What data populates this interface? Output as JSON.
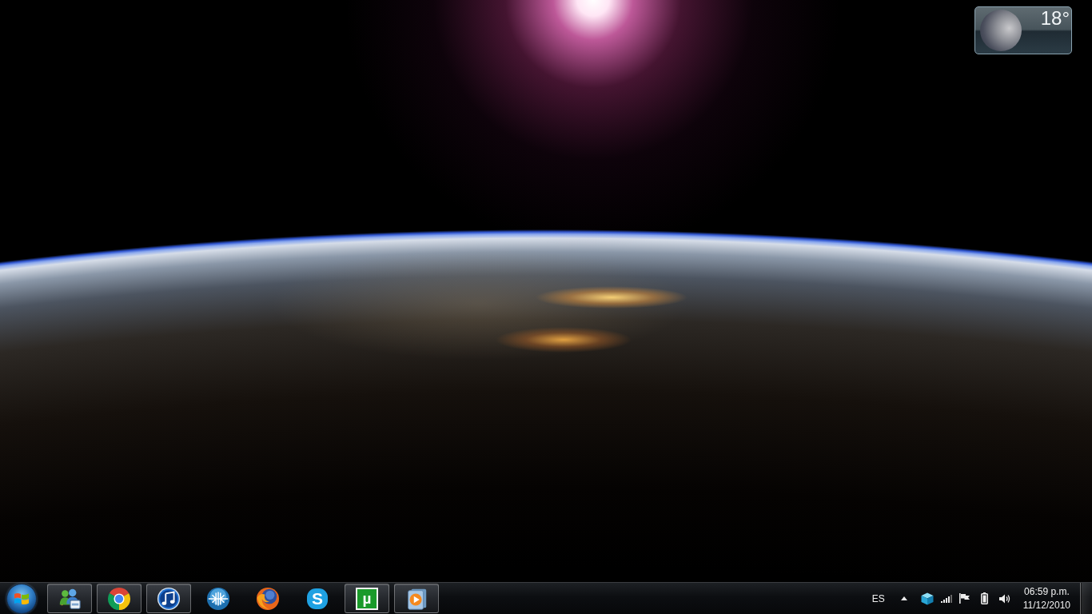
{
  "gadget": {
    "temperature": "18°"
  },
  "taskbar": {
    "apps": [
      {
        "kind": "people",
        "running": true
      },
      {
        "kind": "ring",
        "running": true
      },
      {
        "kind": "note",
        "running": true
      },
      {
        "kind": "disc",
        "running": false
      },
      {
        "kind": "globe",
        "running": false
      },
      {
        "kind": "letter_cloud",
        "glyph": "S",
        "running": false
      },
      {
        "kind": "letter_tile",
        "glyph": "µ",
        "running": true
      },
      {
        "kind": "play",
        "running": true
      }
    ]
  },
  "tray": {
    "language": "ES",
    "icons": [
      {
        "kind": "caret"
      },
      {
        "kind": "cube"
      },
      {
        "kind": "signal"
      },
      {
        "kind": "flag"
      },
      {
        "kind": "battery"
      },
      {
        "kind": "speaker"
      }
    ],
    "clock": {
      "time": "06:59 p.m.",
      "date": "11/12/2010"
    }
  }
}
